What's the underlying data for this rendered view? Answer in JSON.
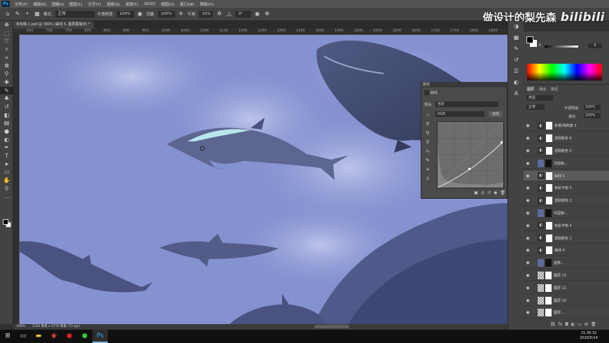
{
  "menubar": {
    "logo": "Ps",
    "items": [
      "文件(F)",
      "编辑(E)",
      "图像(I)",
      "图层(L)",
      "文字(Y)",
      "选择(S)",
      "滤镜(T)",
      "3D(D)",
      "视图(V)",
      "窗口(W)",
      "帮助(H)"
    ]
  },
  "watermark": {
    "text": "做设计的梨先森",
    "brand": "bilibili"
  },
  "options": {
    "mode_label": "模式:",
    "mode_value": "正常",
    "opacity_label": "不透明度:",
    "opacity_value": "100%",
    "flow_label": "流量:",
    "flow_value": "100%",
    "smooth_label": "平滑:",
    "smooth_value": "10%",
    "angle_value": "0°"
  },
  "document": {
    "tab_title": "未标题-1.psd @ 300% (曲线 5, 图层蒙版/8) *"
  },
  "ruler_labels": [
    "600",
    "700",
    "750",
    "800",
    "850",
    "900",
    "950",
    "1000",
    "1050",
    "1100",
    "1150",
    "1200",
    "1250",
    "1300",
    "1350",
    "1400",
    "1450",
    "1500",
    "1550",
    "1600",
    "1650",
    "1700",
    "1750",
    "1800",
    "1850"
  ],
  "status": {
    "zoom": "300%",
    "size": "3183 像素 x 4719 像素 (72 ppi)"
  },
  "color_panel": {
    "k_label": "K",
    "k_value": "0",
    "fg_color": "#000000",
    "bg_color": "#ffffff"
  },
  "layers_panel": {
    "tabs": [
      "图层",
      "通道",
      "路径"
    ],
    "filter": "类型",
    "blend": "正常",
    "opacity_label": "不透明度:",
    "opacity_value": "100%",
    "fill_label": "填充:",
    "fill_value": "100%",
    "layers": [
      {
        "name": "色相/饱和度 3",
        "kind": "adj"
      },
      {
        "name": "选取颜色 6",
        "kind": "adj"
      },
      {
        "name": "选取颜色 5",
        "kind": "adj"
      },
      {
        "name": "深蓝鲸...",
        "kind": "img"
      },
      {
        "name": "曲线 5",
        "kind": "adj",
        "selected": true
      },
      {
        "name": "色彩平衡 5",
        "kind": "adj"
      },
      {
        "name": "选取颜色 2",
        "kind": "adj"
      },
      {
        "name": "鸡蛋鲸...",
        "kind": "img"
      },
      {
        "name": "色彩平衡 4",
        "kind": "adj"
      },
      {
        "name": "选取颜色 1",
        "kind": "adj"
      },
      {
        "name": "曲线 4",
        "kind": "adj"
      },
      {
        "name": "鱼群...",
        "kind": "img"
      },
      {
        "name": "图层 12",
        "kind": "checker"
      },
      {
        "name": "图层 11",
        "kind": "checker"
      },
      {
        "name": "图层 10",
        "kind": "checker"
      },
      {
        "name": "图层 ...",
        "kind": "checker"
      }
    ]
  },
  "curves_panel": {
    "title": "属性",
    "subtitle": "曲线",
    "preset_label": "预设:",
    "preset_value": "自定",
    "channel_value": "RGB",
    "auto_label": "自动"
  },
  "taskbar": {
    "time": "21:36:32",
    "date": "2020/5/14"
  }
}
